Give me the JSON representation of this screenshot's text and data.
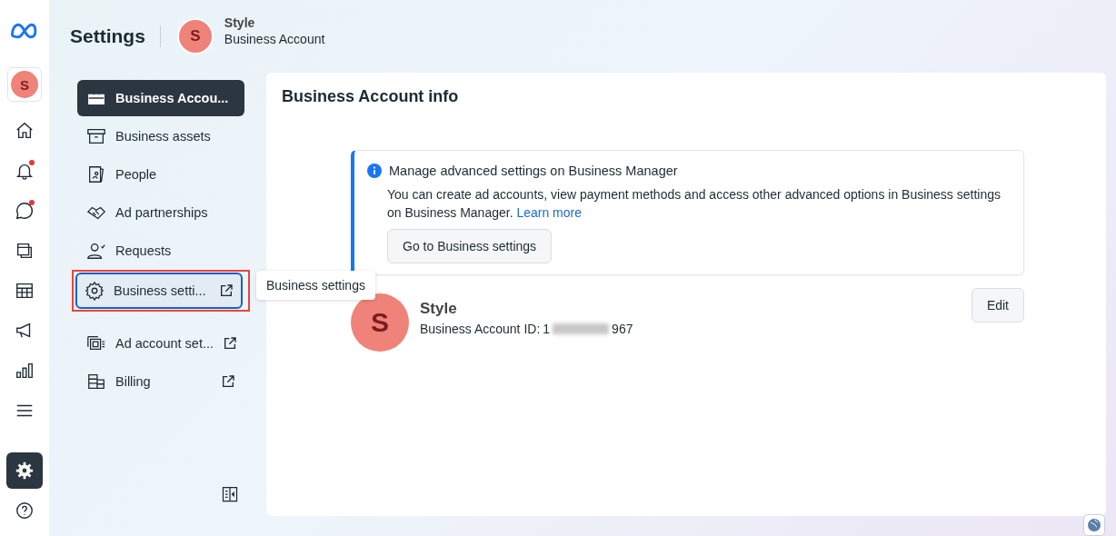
{
  "header": {
    "title": "Settings",
    "account_initial": "S",
    "account_name": "Style",
    "account_type": "Business Account"
  },
  "rail": [
    {
      "selected": false,
      "badge": false
    },
    {
      "selected": false,
      "badge": true
    },
    {
      "selected": false,
      "badge": true
    },
    {
      "selected": false,
      "badge": false
    },
    {
      "selected": false,
      "badge": false
    },
    {
      "selected": false,
      "badge": false
    },
    {
      "selected": false,
      "badge": false
    },
    {
      "selected": false,
      "badge": false
    },
    {
      "selected": true,
      "badge": false
    },
    {
      "selected": false,
      "badge": false
    }
  ],
  "rail_avatar": "S",
  "nav": [
    {
      "label": "Business Accou...",
      "selected": true,
      "focused": false,
      "external": false
    },
    {
      "label": "Business assets",
      "selected": false,
      "focused": false,
      "external": false
    },
    {
      "label": "People",
      "selected": false,
      "focused": false,
      "external": false
    },
    {
      "label": "Ad partnerships",
      "selected": false,
      "focused": false,
      "external": false
    },
    {
      "label": "Requests",
      "selected": false,
      "focused": false,
      "external": false
    },
    {
      "label": "Business setti...",
      "selected": false,
      "focused": true,
      "external": true
    },
    {
      "label": "Ad account set...",
      "selected": false,
      "focused": false,
      "external": true
    },
    {
      "label": "Billing",
      "selected": false,
      "focused": false,
      "external": true
    }
  ],
  "tooltip": "Business settings",
  "main": {
    "title": "Business Account info",
    "notice": {
      "title": "Manage advanced settings on Business Manager",
      "body": "You can create ad accounts, view payment methods and access other advanced options in Business settings on Business Manager.",
      "link": "Learn more",
      "button": "Go to Business settings"
    },
    "account": {
      "initial": "S",
      "name": "Style",
      "id_label": "Business Account ID:",
      "id_start": "1",
      "id_end": "967",
      "edit": "Edit"
    }
  }
}
